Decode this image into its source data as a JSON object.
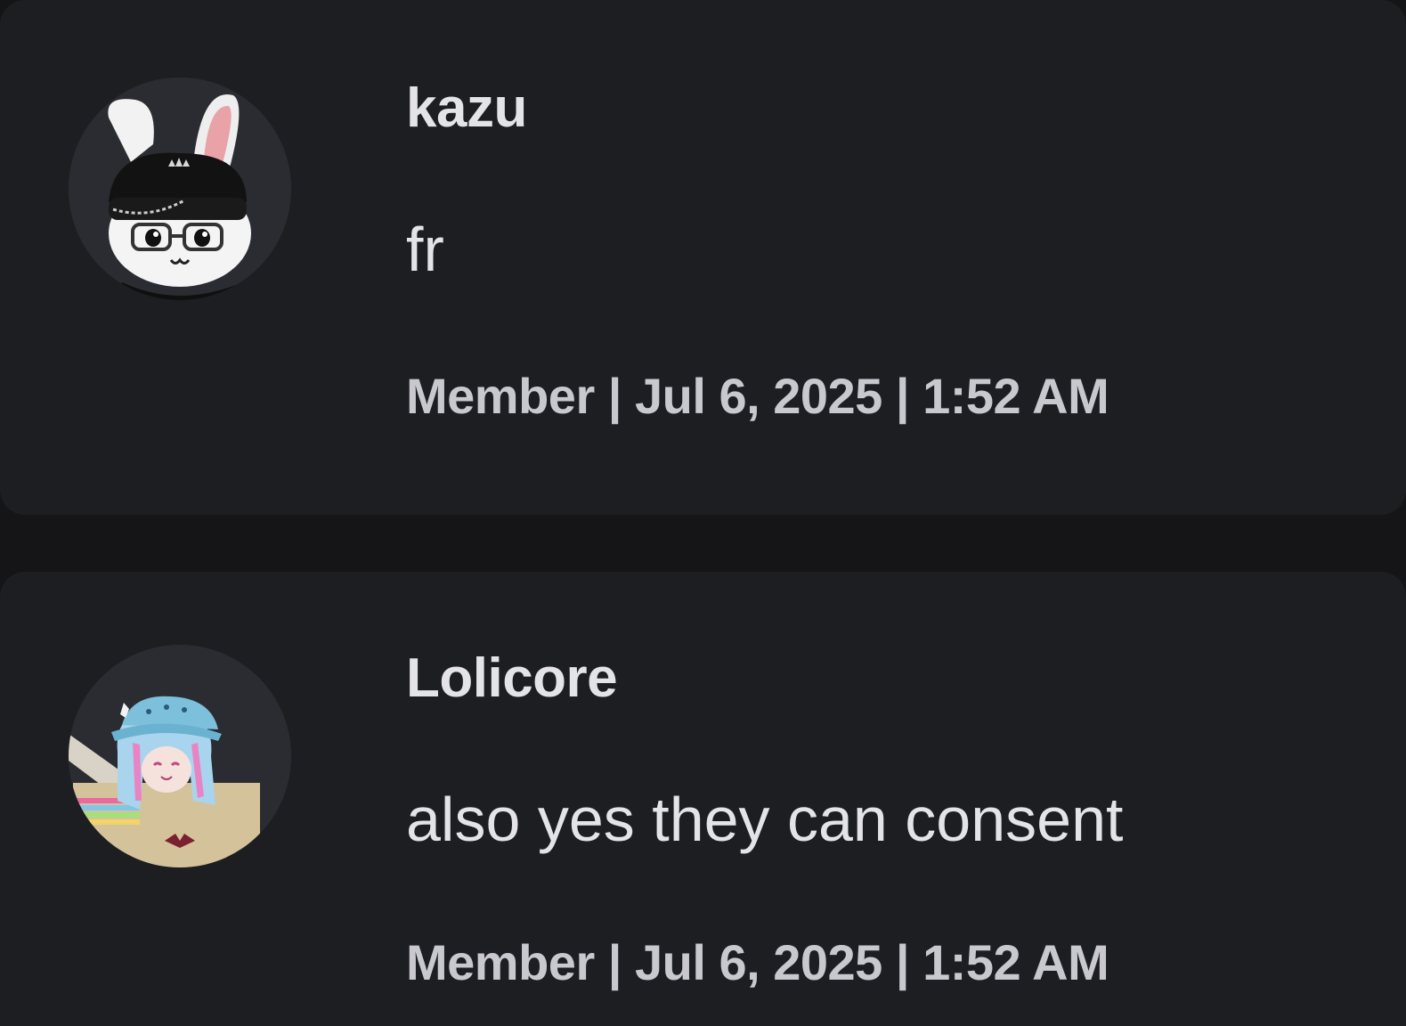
{
  "comments": [
    {
      "username": "kazu",
      "message": "fr",
      "meta": "Member | Jul 6, 2025 | 1:52 AM",
      "avatar_icon": "bunny-avatar-icon"
    },
    {
      "username": "Lolicore",
      "message": "also yes they can consent",
      "meta": "Member | Jul 6, 2025 | 1:52 AM",
      "avatar_icon": "anime-avatar-icon"
    }
  ],
  "colors": {
    "page_background": "#151517",
    "card_background": "#1d1e22",
    "text_primary": "#e4e4e8",
    "text_meta": "#c8c8ce"
  }
}
